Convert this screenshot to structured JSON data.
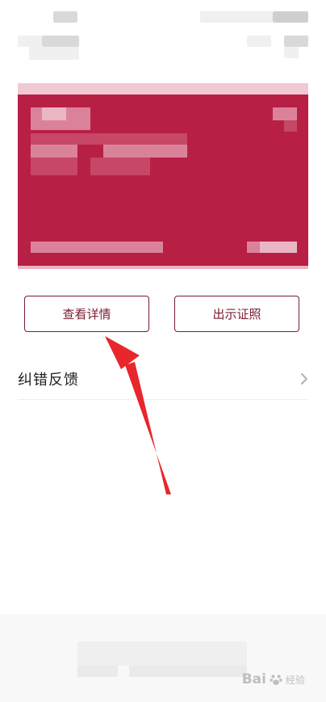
{
  "actions": {
    "view_details_label": "查看详情",
    "show_certificate_label": "出示证照"
  },
  "feedback": {
    "label": "纠错反馈",
    "chevron_icon": "chevron-right-icon"
  },
  "watermark": {
    "brand": "Bai",
    "brand_suffix": "经验"
  },
  "colors": {
    "card_red": "#b81f45",
    "button_border": "#7a1c30",
    "arrow_red": "#e8262c"
  }
}
